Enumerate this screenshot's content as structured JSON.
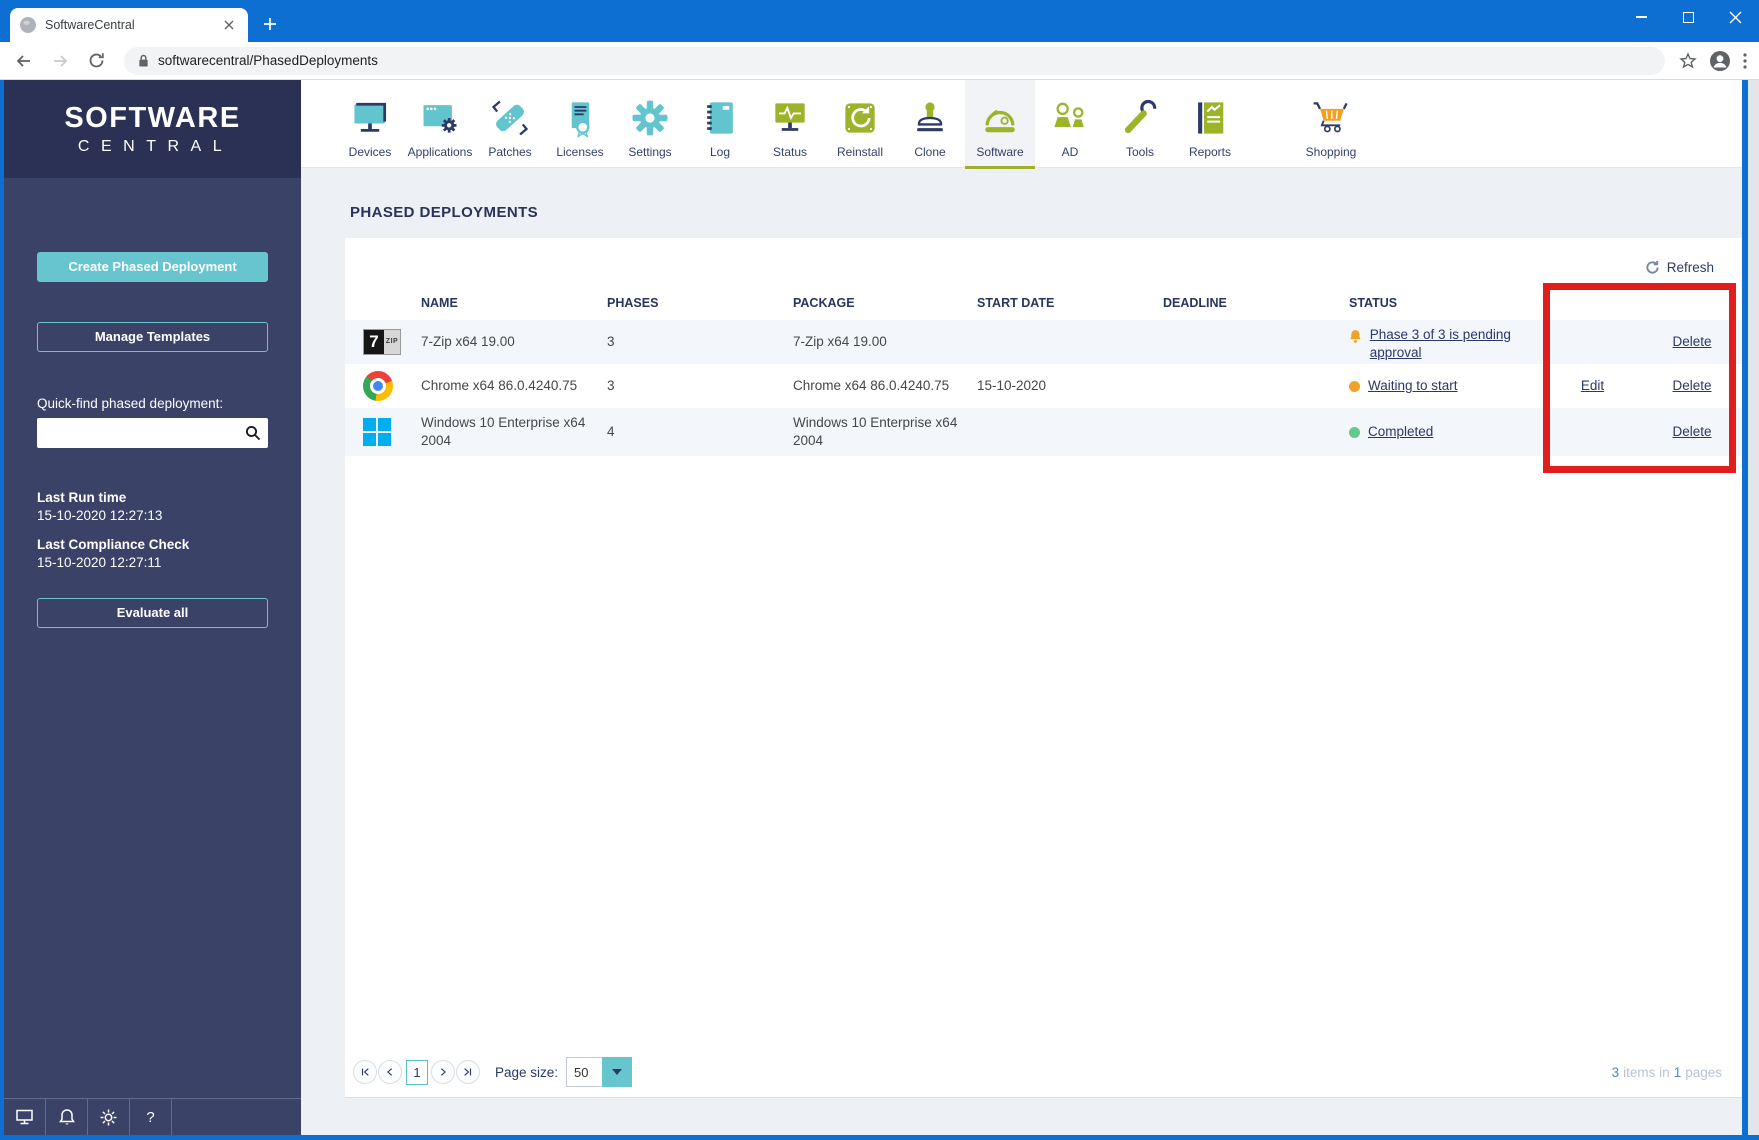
{
  "browser": {
    "tab_title": "SoftwareCentral",
    "url": "softwarecentral/PhasedDeployments"
  },
  "logo": {
    "line1": "SOFTWARE",
    "line2": "CENTRAL"
  },
  "nav": {
    "selected": "Software",
    "items": [
      "Devices",
      "Applications",
      "Patches",
      "Licenses",
      "Settings",
      "Log",
      "Status",
      "Reinstall",
      "Clone",
      "Software",
      "AD",
      "Tools",
      "Reports",
      "Shopping"
    ]
  },
  "sidebar": {
    "create_button": "Create Phased Deployment",
    "manage_button": "Manage Templates",
    "quickfind_label": "Quick-find phased deployment:",
    "search_value": "",
    "last_run_label": "Last Run time",
    "last_run_value": "15-10-2020 12:27:13",
    "last_compliance_label": "Last Compliance Check",
    "last_compliance_value": "15-10-2020 12:27:11",
    "evaluate_button": "Evaluate all"
  },
  "main": {
    "title": "PHASED DEPLOYMENTS",
    "refresh_label": "Refresh"
  },
  "table": {
    "headers": [
      "NAME",
      "PHASES",
      "PACKAGE",
      "START DATE",
      "DEADLINE",
      "STATUS"
    ],
    "rows": [
      {
        "name": "7-Zip x64 19.00",
        "phases": "3",
        "package": "7-Zip x64 19.00",
        "start_date": "",
        "deadline": "",
        "status": "Phase 3 of 3 is pending approval",
        "status_icon": "bell-icon",
        "edit": "",
        "delete": "Delete",
        "app_icon": "7zip-icon"
      },
      {
        "name": "Chrome x64 86.0.4240.75",
        "phases": "3",
        "package": "Chrome x64 86.0.4240.75",
        "start_date": "15-10-2020",
        "deadline": "",
        "status": "Waiting to start",
        "status_icon": "orange-dot-icon",
        "edit": "Edit",
        "delete": "Delete",
        "app_icon": "chrome-icon"
      },
      {
        "name": "Windows 10 Enterprise x64 2004",
        "phases": "4",
        "package": "Windows 10 Enterprise x64 2004",
        "start_date": "",
        "deadline": "",
        "status": "Completed",
        "status_icon": "green-dot-icon",
        "edit": "",
        "delete": "Delete",
        "app_icon": "windows-icon"
      }
    ]
  },
  "seven_zip_icon_text": {
    "seven": "7",
    "zip": "ZIP"
  },
  "pagination": {
    "current_page": "1",
    "page_size_label": "Page size:",
    "page_size_value": "50",
    "summary_count": "3",
    "summary_items_text": "items in",
    "summary_pages_count": "1",
    "summary_pages_text": "pages"
  },
  "icons": {
    "search": "magnifier",
    "refresh": "circular-arrows",
    "pending_status": "orange-bell",
    "waiting_status": "orange-dot",
    "completed_status": "green-dot",
    "pager": "first/prev/next/last arrows",
    "sidebar_bottom": "monitor, bell, gear, help"
  },
  "colors": {
    "titlebar_blue": "#0e6fd3",
    "sidebar_header": "#2b3154",
    "sidebar_body": "#3a4268",
    "teal_accent": "#62c4cc",
    "olive_accent": "#9db32a",
    "navy_text": "#2b3768",
    "orange_status": "#f0a128",
    "green_status": "#64c98c",
    "highlight_red": "#e21d1d",
    "row_alt": "#f3f7fb",
    "content_bg": "#edf0f4",
    "shopping_orange": "#f3a01f"
  }
}
